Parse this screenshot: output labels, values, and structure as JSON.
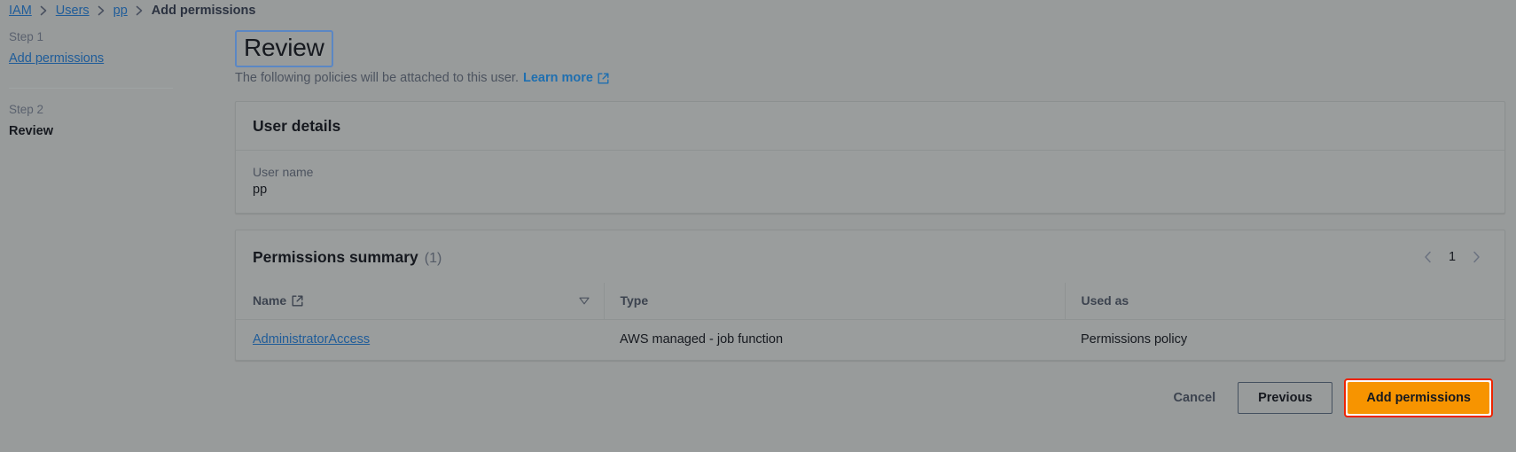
{
  "breadcrumb": {
    "items": [
      {
        "label": "IAM",
        "current": false
      },
      {
        "label": "Users",
        "current": false
      },
      {
        "label": "pp",
        "current": false
      },
      {
        "label": "Add permissions",
        "current": true
      }
    ]
  },
  "steps": [
    {
      "kicker": "Step 1",
      "label": "Add permissions",
      "current": false
    },
    {
      "kicker": "Step 2",
      "label": "Review",
      "current": true
    }
  ],
  "header": {
    "title": "Review",
    "subtitle": "The following policies will be attached to this user.",
    "learn_more": "Learn more",
    "external_icon": "external-link-icon"
  },
  "user_details": {
    "title": "User details",
    "user_name_label": "User name",
    "user_name_value": "pp"
  },
  "permissions_summary": {
    "title": "Permissions summary",
    "count": "(1)",
    "pagination": {
      "prev_icon": "chevron-left-icon",
      "page": "1",
      "next_icon": "chevron-right-icon"
    },
    "columns": [
      {
        "label": "Name",
        "icon": "external-link-icon",
        "sort_icon": "sort-descending-icon"
      },
      {
        "label": "Type"
      },
      {
        "label": "Used as"
      }
    ],
    "rows": [
      {
        "name": "AdministratorAccess",
        "type": "AWS managed - job function",
        "used_as": "Permissions policy"
      }
    ]
  },
  "footer": {
    "cancel": "Cancel",
    "previous": "Previous",
    "submit": "Add permissions"
  },
  "colors": {
    "link": "#1f5c99",
    "primary_button": "#f79400",
    "highlight_ring": "#ee2200",
    "focus_ring": "#5b87c4",
    "page_background": "#989b9b"
  }
}
